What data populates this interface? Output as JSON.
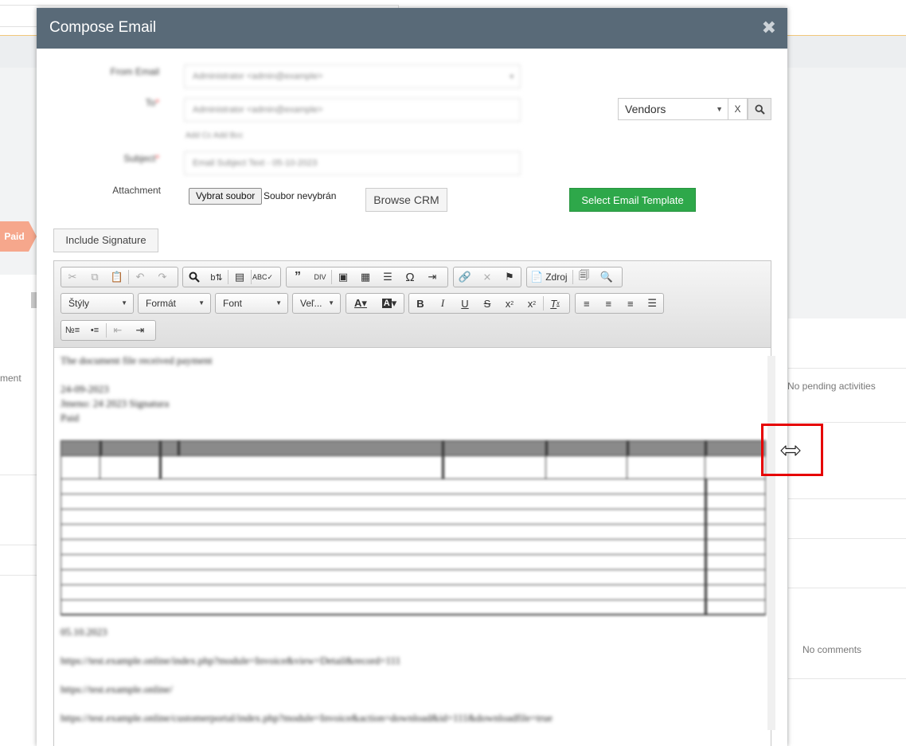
{
  "background": {
    "paid_badge": "Paid",
    "left_fragment": "ment",
    "no_pending": "No pending activities",
    "no_comments": "No comments"
  },
  "modal": {
    "title": "Compose Email",
    "close_icon": "close-icon",
    "form": {
      "from_label": "From Email",
      "from_value": "Administrator <admin@example>",
      "to_label": "To",
      "to_value": "Administrator <admin@example>",
      "cc_links": "Add Cc  Add Bcc",
      "subject_label": "Subject",
      "subject_value": "Email Subject Text - 05-10-2023",
      "required_mark": "*",
      "attachment_label": "Attachment",
      "file_button": "Vybrat soubor",
      "file_status": "Soubor nevybrán",
      "browse_crm": "Browse CRM",
      "select_template": "Select Email Template",
      "include_signature": "Include Signature"
    },
    "vendors": {
      "selected": "Vendors",
      "clear": "X",
      "search_icon": "search-icon"
    },
    "editor": {
      "combos": {
        "styles": "Štýly",
        "format": "Formát",
        "font": "Font",
        "size": "Veľ..."
      },
      "source_label": "Zdroj",
      "content": {
        "line1": "The document file received payment",
        "line2": "24-09-2023",
        "line3": "Jmeno: 24 2023 Signatura",
        "line4": "Paid",
        "after_table": "05.10.2023",
        "link1": "https://test.example.online/index.php?module=Invoice&view=Detail&record=111",
        "link2": "https://test.example.online/",
        "link3": "https://test.example.online/customerportal/index.php?module=Invoice&action=download&id=111&downloadfile=true"
      }
    }
  },
  "highlight": {
    "color": "#e60000",
    "icon": "resize-horizontal-icon"
  },
  "colors": {
    "header_bg": "#596a78",
    "template_btn": "#2ea84a",
    "paid_badge": "#f6a78c"
  }
}
